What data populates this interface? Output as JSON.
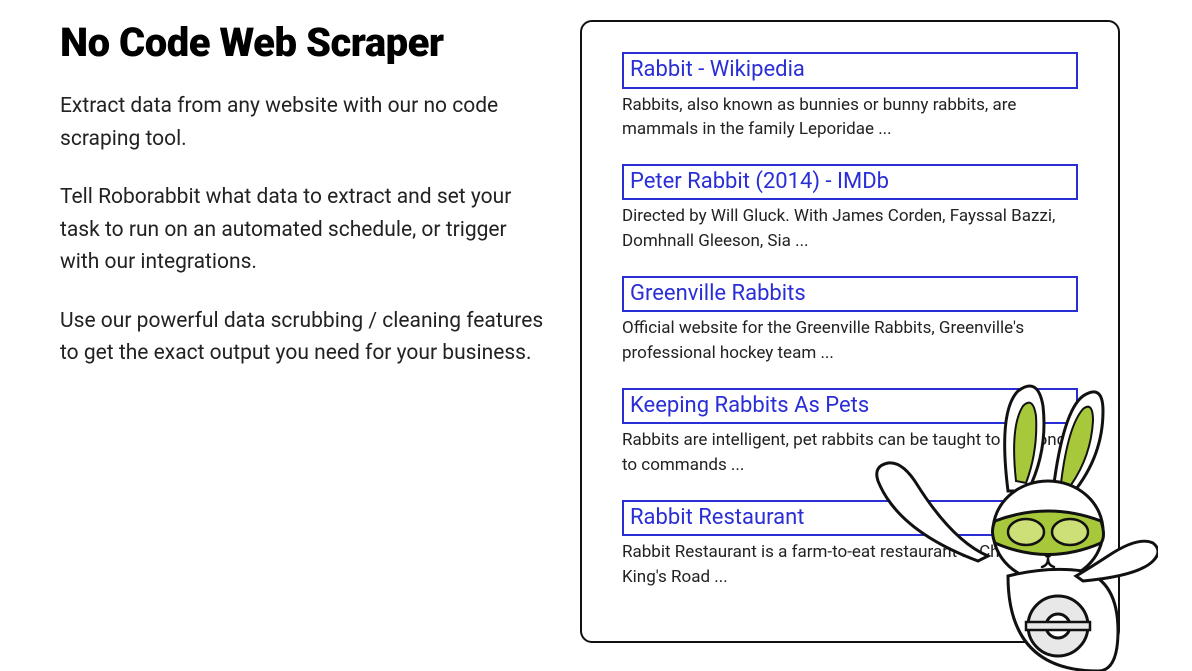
{
  "heading": "No Code Web Scraper",
  "paragraphs": [
    "Extract data from any website with our no code scraping tool.",
    "Tell Roborabbit what data to extract and set your task to run on an automated schedule, or trigger with our integrations.",
    "Use our powerful data scrubbing / cleaning features to get the exact output you need for your business."
  ],
  "results": [
    {
      "title": "Rabbit - Wikipedia",
      "snippet": "Rabbits, also known as bunnies or bunny rabbits, are mammals in the family Leporidae ..."
    },
    {
      "title": "Peter Rabbit (2014) - IMDb",
      "snippet": "Directed by Will Gluck. With James Corden, Fayssal Bazzi, Domhnall Gleeson, Sia ..."
    },
    {
      "title": "Greenville Rabbits",
      "snippet": "Official website for the Greenville Rabbits, Greenville's professional hockey team ..."
    },
    {
      "title": "Keeping Rabbits As Pets",
      "snippet": "Rabbits are intelligent, pet rabbits can be taught to respond to commands ..."
    },
    {
      "title": "Rabbit Restaurant",
      "snippet": "Rabbit Restaurant is a farm-to-eat restaurant in Chelsea on King's Road ..."
    }
  ]
}
